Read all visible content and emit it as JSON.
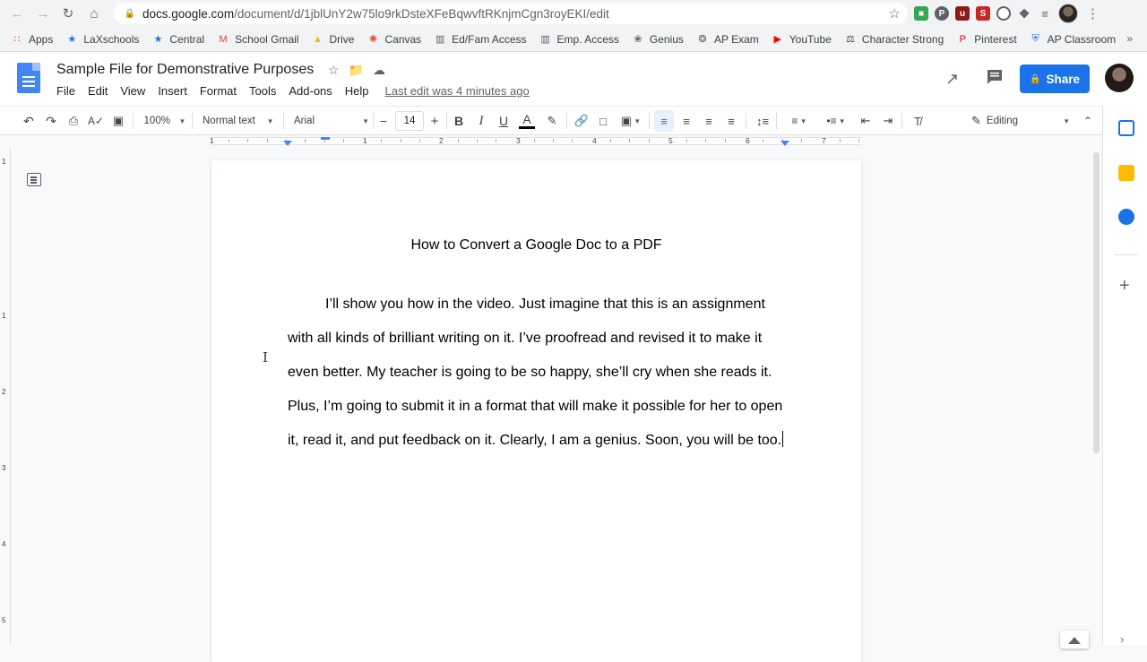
{
  "browser": {
    "url_host": "docs.google.com",
    "url_path": "/document/d/1jblUnY2w75lo9rkDsteXFeBqwvftRKnjmCgn3royEKI/edit"
  },
  "bookmarks": [
    {
      "label": "Apps",
      "icon": "apps-grid-icon",
      "color": "#ea4335"
    },
    {
      "label": "LaXschools",
      "icon": "laxschools-star-icon",
      "color": "#1a73e8"
    },
    {
      "label": "Central",
      "icon": "central-star-icon",
      "color": "#1a73e8"
    },
    {
      "label": "School Gmail",
      "icon": "gmail-icon",
      "color": "#ea4335"
    },
    {
      "label": "Drive",
      "icon": "drive-icon",
      "color": "#fbbc04"
    },
    {
      "label": "Canvas",
      "icon": "canvas-icon",
      "color": "#e1522d"
    },
    {
      "label": "Ed/Fam Access",
      "icon": "ed-fam-access-icon",
      "color": "#5f6368"
    },
    {
      "label": "Emp. Access",
      "icon": "emp-access-icon",
      "color": "#5f6368"
    },
    {
      "label": "Genius",
      "icon": "genius-bulb-icon",
      "color": "#5f6368"
    },
    {
      "label": "AP Exam",
      "icon": "ap-exam-icon",
      "color": "#5f6368"
    },
    {
      "label": "YouTube",
      "icon": "youtube-icon",
      "color": "#ff0000"
    },
    {
      "label": "Character Strong",
      "icon": "character-strong-icon",
      "color": "#3c4043"
    },
    {
      "label": "Pinterest",
      "icon": "pinterest-icon",
      "color": "#e60023"
    },
    {
      "label": "AP Classroom",
      "icon": "ap-classroom-icon",
      "color": "#1a73e8"
    }
  ],
  "docs": {
    "title": "Sample File for Demonstrative Purposes",
    "menus": [
      "File",
      "Edit",
      "View",
      "Insert",
      "Format",
      "Tools",
      "Add-ons",
      "Help"
    ],
    "last_edit": "Last edit was 4 minutes ago",
    "share_label": "Share"
  },
  "toolbar": {
    "zoom": "100%",
    "style": "Normal text",
    "font": "Arial",
    "font_size": "14",
    "mode": "Editing"
  },
  "ruler": {
    "numbers": [
      "1",
      "1",
      "2",
      "3",
      "4",
      "5",
      "6",
      "7"
    ]
  },
  "vruler": {
    "numbers": [
      "1",
      "1",
      "2",
      "3",
      "4",
      "5"
    ]
  },
  "document": {
    "heading": "How to Convert a Google Doc to a PDF",
    "body": "I’ll show you how in the video. Just imagine that this is an assignment with all kinds of brilliant writing on it. I’ve proofread and revised it to make it even better. My teacher is going to be so happy, she’ll cry when she reads it. Plus, I’m going to submit it in a format that will make it possible for her to open it, read it, and put feedback on it. Clearly, I am a genius. Soon, you will be too."
  },
  "colors": {
    "accent": "#1a73e8",
    "docs_blue": "#4285f4"
  }
}
